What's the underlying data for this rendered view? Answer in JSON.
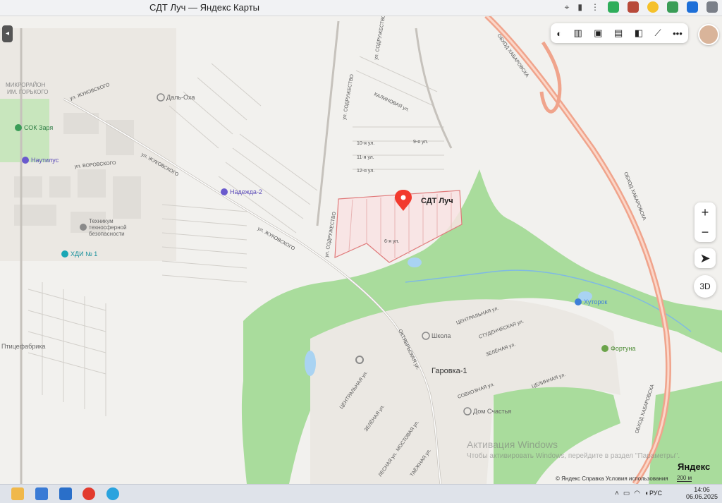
{
  "window": {
    "title": "СДТ Луч — Яндекс Карты"
  },
  "map_labels": {
    "place_title": "СДТ Луч",
    "mikrorayon": "МИКРОРАЙОН",
    "im_gorkogo": "ИМ. ГОРЬКОГО",
    "dal_okha": "Даль-Оха",
    "sok_zarya": "СОК Заря",
    "nautilus": "Наутилус",
    "nadezhda2": "Надежда-2",
    "technikum1": "Техникум",
    "technikum2": "техносферной",
    "technikum3": "безопасности",
    "hdi": "ХДИ № 1",
    "ptitsefabrika": "Птицефабрика",
    "khutorok": "Хуторок",
    "fortuna": "Фортуна",
    "shkola": "Школа",
    "garovka": "Гаровка-1",
    "dom_schastya": "Дом Счастья",
    "road_obkhod1": "ОБХОД ХАБАРОВСКА",
    "road_obkhod2": "ОБХОД ХАБАРОВСКА",
    "road_obkhod3": "ОБХОД ХАБАРОВСКА",
    "ul_zhukovskogo1": "ул. ЖУКОВСКОГО",
    "ul_zhukovskogo2": "ул. ЖУКОВСКОГО",
    "ul_zhukovskogo3": "ул. ЖУКОВСКОГО",
    "ul_vorovskogo": "ул. ВОРОВСКОГО",
    "ul_sodruzhestvo1": "ул. СОДРУЖЕСТВО",
    "ul_sodruzhestvo2": "ул. СОДРУЖЕСТВО",
    "ul_sodruzhestvo3": "ул. СОДРУЖЕСТВО",
    "kalinovaya": "КАЛИНОВАЯ ул.",
    "oktyabrskaya": "ОКТЯБРЬСКАЯ ул.",
    "tsentralnaya1": "ЦЕНТРАЛЬНАЯ ул.",
    "tsentralnaya2": "ЦЕНТРАЛЬНАЯ ул.",
    "studencheskaya": "СТУДЕНЧЕСКАЯ ул.",
    "zelenaya1": "ЗЕЛЁНАЯ ул.",
    "zelenaya2": "ЗЕЛЁНАЯ ул.",
    "sovkhoznaya": "СОВХОЗНАЯ ул.",
    "tselinnaya": "ЦЕЛИННАЯ ул.",
    "mostovaya": "МОСТОВАЯ ул.",
    "lesnaya": "ЛЕСНАЯ ул.",
    "taezhnaya": "ТАЁЖНАЯ ул.",
    "ul_9": "9-я ул.",
    "ul_10": "10-я ул.",
    "ul_11": "11-я ул.",
    "ul_12": "12-я ул.",
    "ul_6": "6-я ул."
  },
  "toolbar": {
    "items": [
      "layers-icon",
      "panorama-icon",
      "camera-icon",
      "transport-icon",
      "traffic-icon",
      "ruler-icon",
      "more-icon"
    ],
    "more_label": "•••"
  },
  "controls": {
    "zoom_in": "+",
    "zoom_out": "−",
    "mode_3d": "3D"
  },
  "footer": {
    "copyright": "© Яндекс   Справка   Условия использования",
    "scale": "200 м",
    "logo": "Яндекс"
  },
  "watermark": {
    "line1": "Активация Windows",
    "line2": "Чтобы активировать Windows, перейдите в раздел \"Параметры\"."
  },
  "taskbar": {
    "lang": "РУС",
    "time": "14:06",
    "date": "06.06.2025"
  },
  "colors": {
    "forest": "#a9dc9c",
    "water": "#a9d3f2",
    "highway": "#f0a48c",
    "marker": "#f23a2e",
    "selection": "#f9e3e3"
  }
}
